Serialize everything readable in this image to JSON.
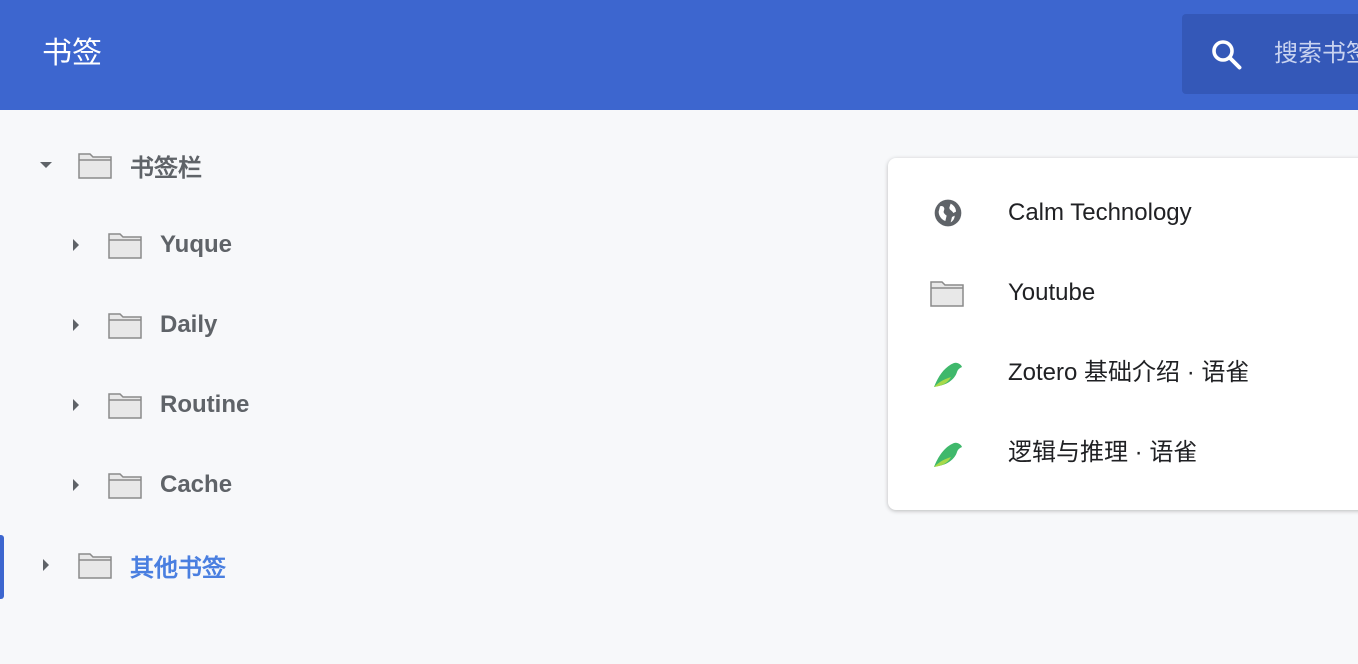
{
  "header": {
    "title": "书签",
    "search_placeholder": "搜索书签"
  },
  "tree": {
    "root": {
      "label": "书签栏",
      "expanded": true
    },
    "children": [
      {
        "label": "Yuque"
      },
      {
        "label": "Daily"
      },
      {
        "label": "Routine"
      },
      {
        "label": "Cache"
      }
    ],
    "other": {
      "label": "其他书签",
      "selected": true
    }
  },
  "panel": {
    "items": [
      {
        "label": "Calm Technology",
        "icon": "globe-icon"
      },
      {
        "label": "Youtube",
        "icon": "folder-icon"
      },
      {
        "label": "Zotero 基础介绍 · 语雀",
        "icon": "yuque-icon"
      },
      {
        "label": "逻辑与推理 · 语雀",
        "icon": "yuque-icon"
      }
    ]
  },
  "colors": {
    "header": "#3d66cf",
    "search": "#3458b8",
    "selected": "#4a7fe0"
  }
}
